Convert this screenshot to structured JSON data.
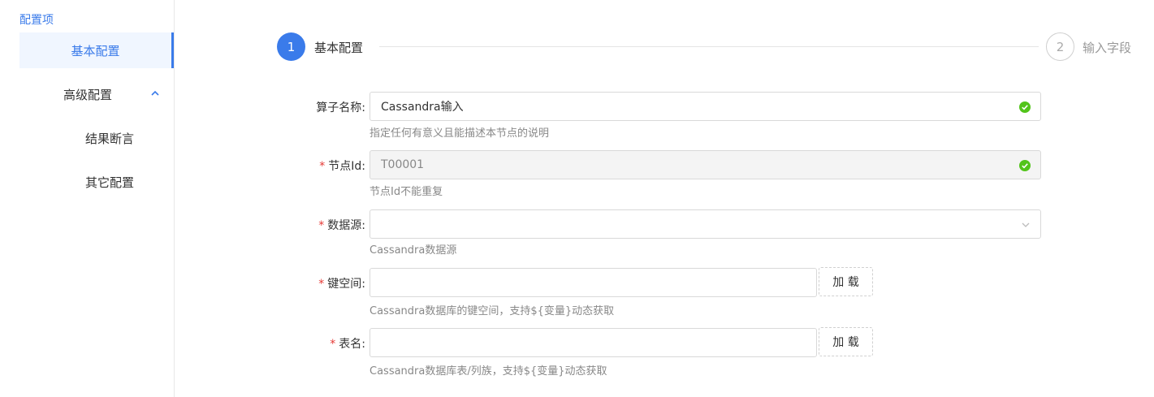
{
  "sidebar": {
    "title": "配置项",
    "items": [
      {
        "label": "基本配置"
      },
      {
        "label": "高级配置"
      },
      {
        "label": "结果断言"
      },
      {
        "label": "其它配置"
      }
    ]
  },
  "steps": [
    {
      "number": "1",
      "label": "基本配置"
    },
    {
      "number": "2",
      "label": "输入字段"
    }
  ],
  "form": {
    "operator_name": {
      "label": "算子名称:",
      "value": "Cassandra输入",
      "hint": "指定任何有意义且能描述本节点的说明"
    },
    "node_id": {
      "label": "节点Id:",
      "value": "T00001",
      "hint": "节点Id不能重复"
    },
    "datasource": {
      "label": "数据源:",
      "value": "",
      "hint": "Cassandra数据源"
    },
    "keyspace": {
      "label": "键空间:",
      "value": "",
      "hint": "Cassandra数据库的键空间，支持${变量}动态获取",
      "button": "加 载"
    },
    "table": {
      "label": "表名:",
      "value": "",
      "hint": "Cassandra数据库表/列族，支持${变量}动态获取",
      "button": "加 载"
    },
    "required_mark": "*"
  },
  "colors": {
    "accent": "#3a7bea",
    "success": "#52c41a",
    "required": "#e53935"
  }
}
